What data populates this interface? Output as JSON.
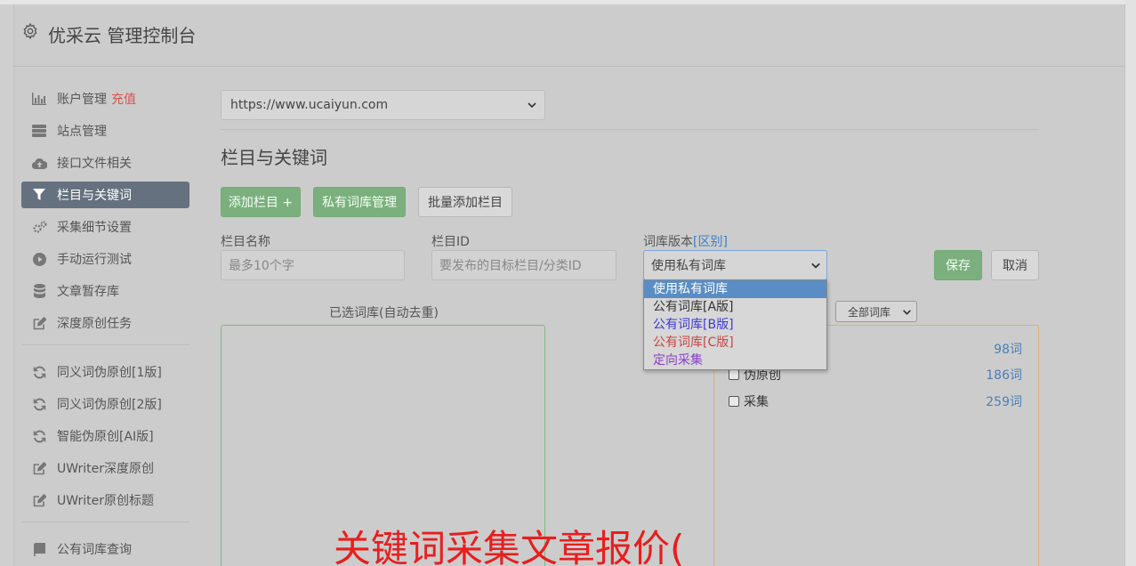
{
  "app": {
    "title": "优采云 管理控制台"
  },
  "sidebar": {
    "items": [
      {
        "label": "账户管理",
        "extra": "充值",
        "icon": "bar-chart-icon"
      },
      {
        "label": "站点管理",
        "icon": "server-icon"
      },
      {
        "label": "接口文件相关",
        "icon": "cloud-upload-icon"
      },
      {
        "label": "栏目与关键词",
        "icon": "filter-icon",
        "active": true
      },
      {
        "label": "采集细节设置",
        "icon": "cogs-icon"
      },
      {
        "label": "手动运行测试",
        "icon": "play-circle-icon"
      },
      {
        "label": "文章暂存库",
        "icon": "database-icon"
      },
      {
        "label": "深度原创任务",
        "icon": "edit-icon"
      },
      {
        "label": "同义词伪原创[1版]",
        "icon": "refresh-icon"
      },
      {
        "label": "同义词伪原创[2版]",
        "icon": "refresh-icon"
      },
      {
        "label": "智能伪原创[AI版]",
        "icon": "refresh-icon"
      },
      {
        "label": "UWriter深度原创",
        "icon": "edit-icon"
      },
      {
        "label": "UWriter原创标题",
        "icon": "edit-icon"
      },
      {
        "label": "公有词库查询",
        "icon": "book-icon"
      }
    ]
  },
  "site_select": {
    "value": "https://www.ucaiyun.com"
  },
  "section": {
    "title": "栏目与关键词"
  },
  "toolbar": {
    "add_column": "添加栏目 +",
    "private_lib": "私有词库管理",
    "batch_add": "批量添加栏目"
  },
  "form": {
    "column_name_label": "栏目名称",
    "column_name_placeholder": "最多10个字",
    "column_id_label": "栏目ID",
    "column_id_placeholder": "要发布的目标栏目/分类ID",
    "lib_version_label": "词库版本",
    "lib_version_link": "[区别]",
    "lib_version_value": "使用私有词库",
    "save": "保存",
    "cancel": "取消"
  },
  "dropdown": {
    "options": [
      {
        "label": "使用私有词库",
        "highlighted": true
      },
      {
        "label": "公有词库[A版]",
        "color": "#333333"
      },
      {
        "label": "公有词库[B版]",
        "color": "#3a3ad6"
      },
      {
        "label": "公有词库[C版]",
        "color": "#c94545"
      },
      {
        "label": "定向采集",
        "color": "#8a3ec9"
      }
    ]
  },
  "selected_lib": {
    "title": "已选词库(自动去重)"
  },
  "all_lib": {
    "filter_value": "全部词库",
    "items": [
      {
        "label": "伪原创",
        "count": "186词"
      },
      {
        "label": "采集",
        "count": "259词"
      }
    ],
    "top_count": "98词"
  },
  "overlay": {
    "text": "关键词采集文章报价("
  },
  "colors": {
    "accent_green": "#7bb07e",
    "active_nav": "#66717f",
    "link": "#3b7fc4",
    "overlay_red": "#e81e1e"
  }
}
